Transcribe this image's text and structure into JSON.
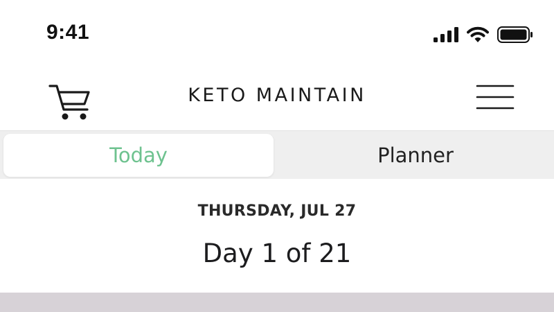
{
  "status_bar": {
    "time": "9:41",
    "icons": [
      "cellular-signal-icon",
      "wifi-icon",
      "battery-icon"
    ]
  },
  "header": {
    "title": "KETO MAINTAIN",
    "left_icon": "cart-icon",
    "right_icon": "hamburger-menu-icon"
  },
  "tabs": [
    {
      "label": "Today",
      "selected": true
    },
    {
      "label": "Planner",
      "selected": false
    }
  ],
  "day": {
    "date": "THURSDAY, JUL 27",
    "progress": "Day 1 of 21"
  },
  "colors": {
    "accent": "#6ec28f",
    "segmented_background": "#efefef",
    "content_strip": "#d7d2d7"
  }
}
